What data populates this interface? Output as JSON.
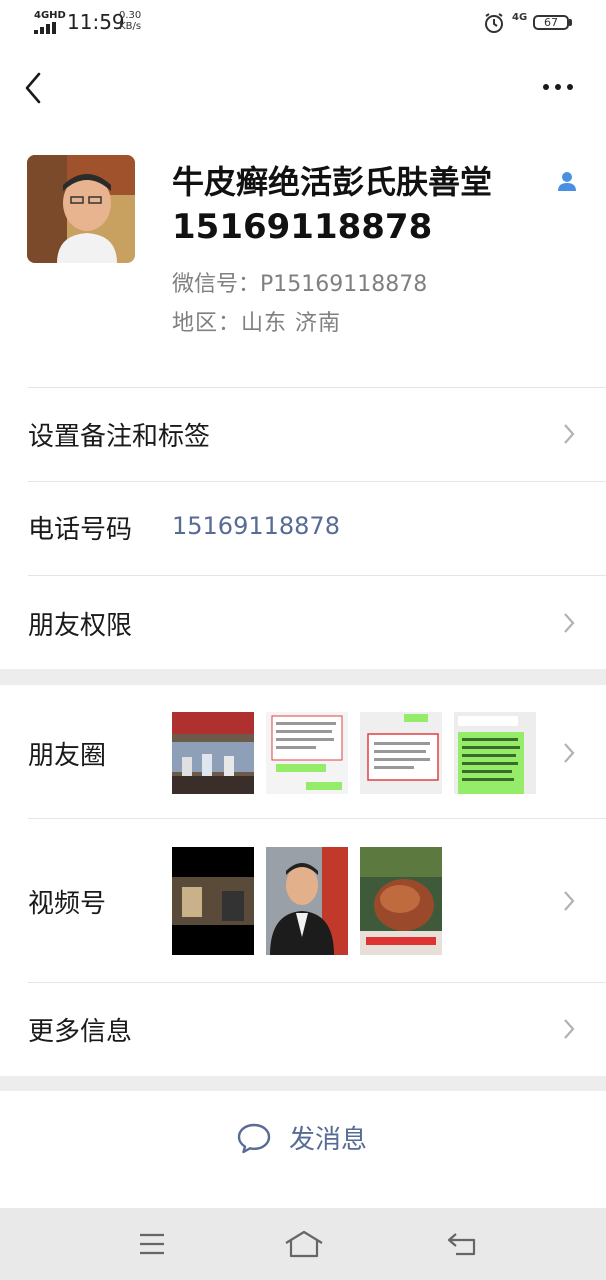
{
  "status_bar": {
    "network": "4GHD",
    "time": "11:59",
    "speed_value": "0.30",
    "speed_unit": "KB/s",
    "cell": "4G",
    "battery": "67"
  },
  "profile": {
    "name_line1": "牛皮癣绝活彭氏肤善堂",
    "name_line2": "15169118878",
    "wechat_id": "微信号：P15169118878",
    "region": "地区：山东  济南"
  },
  "rows": {
    "remark_tags": "设置备注和标签",
    "phone_label": "电话号码",
    "phone_value": "15169118878",
    "permissions": "朋友权限",
    "moments": "朋友圈",
    "channels": "视频号",
    "more_info": "更多信息"
  },
  "actions": {
    "send_message": "发消息"
  },
  "colors": {
    "link": "#576b95",
    "background": "#ededed",
    "divider": "#e5e5e5",
    "gender_icon": "#4a90e2"
  }
}
